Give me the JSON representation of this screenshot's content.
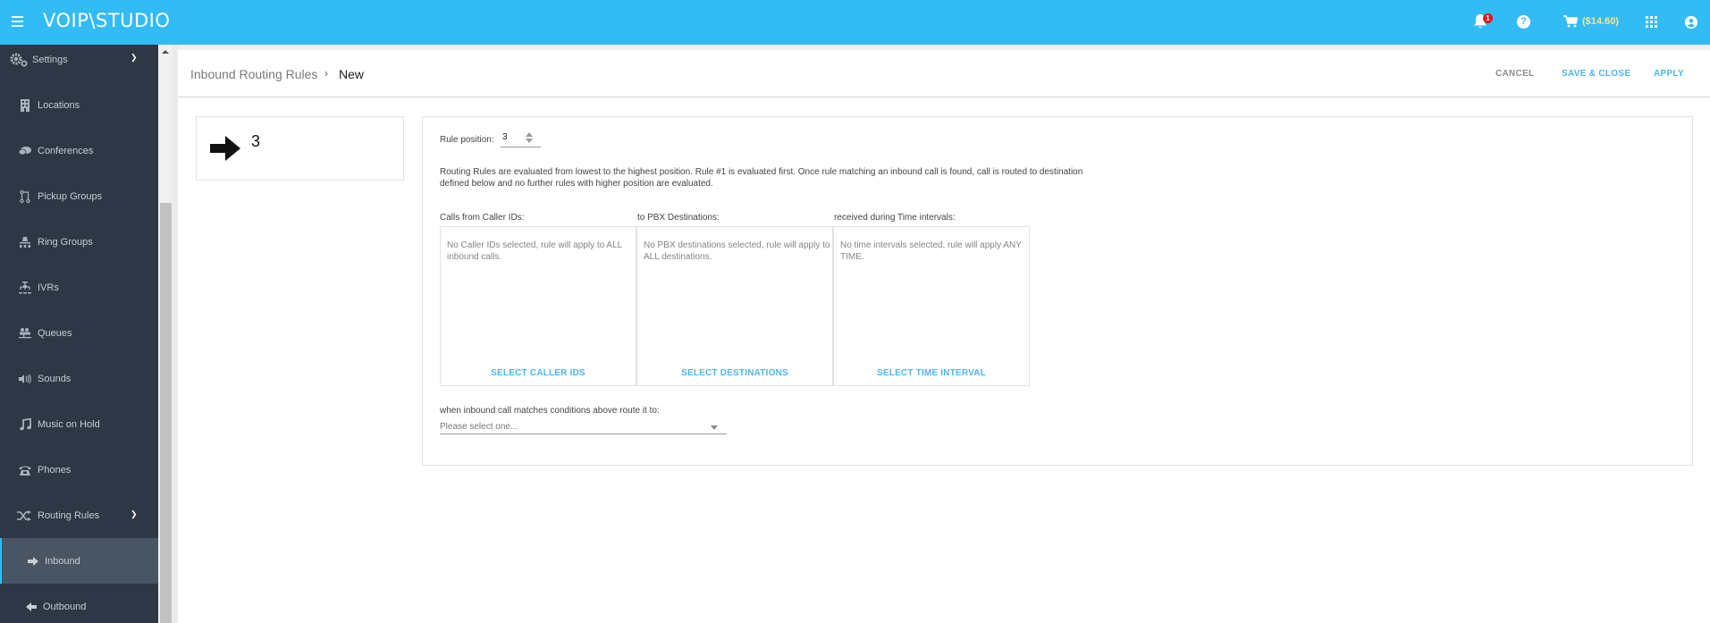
{
  "topbar": {
    "logo": "VOIP\\STUDIO",
    "notification_count": "1",
    "help_glyph": "?",
    "balance": "($14.60)",
    "icons": [
      "hamburger-menu-icon",
      "bell-icon",
      "help-icon",
      "cart-icon",
      "apps-grid-icon",
      "account-icon"
    ]
  },
  "sidebar": {
    "items": [
      {
        "label": "Settings",
        "icon": "gears-icon",
        "expanded": true
      },
      {
        "label": "Locations",
        "icon": "building-icon"
      },
      {
        "label": "Conferences",
        "icon": "chat-bubbles-icon"
      },
      {
        "label": "Pickup Groups",
        "icon": "pickup-group-icon"
      },
      {
        "label": "Ring Groups",
        "icon": "ring-group-icon"
      },
      {
        "label": "IVRs",
        "icon": "ivr-tree-icon"
      },
      {
        "label": "Queues",
        "icon": "queue-icon"
      },
      {
        "label": "Sounds",
        "icon": "speaker-icon"
      },
      {
        "label": "Music on Hold",
        "icon": "music-note-icon"
      },
      {
        "label": "Phones",
        "icon": "telephone-icon"
      },
      {
        "label": "Routing Rules",
        "icon": "shuffle-icon",
        "expanded": true
      },
      {
        "label": "Inbound",
        "icon": "arrow-right-icon",
        "active": true
      },
      {
        "label": "Outbound",
        "icon": "arrow-left-icon"
      }
    ]
  },
  "header": {
    "breadcrumb_parent": "Inbound Routing Rules",
    "breadcrumb_sep": "›",
    "breadcrumb_current": "New",
    "cancel_label": "CANCEL",
    "save_close_label": "SAVE & CLOSE",
    "apply_label": "APPLY"
  },
  "rule_card": {
    "number": "3"
  },
  "form": {
    "rule_position_label": "Rule position:",
    "rule_position_value": "3",
    "description": "Routing Rules are evaluated from lowest to the highest position. Rule #1 is evaluated first. Once rule matching an inbound call is found, call is routed to destination defined below and no further rules with higher position are evaluated.",
    "columns": [
      {
        "label": "Calls from Caller IDs:",
        "empty_text": "No Caller IDs selected, rule will apply to ALL inbound calls.",
        "button": "SELECT CALLER IDS"
      },
      {
        "label": "to PBX Destinations:",
        "empty_text": "No PBX destinations selected, rule will apply to ALL destinations.",
        "button": "SELECT DESTINATIONS"
      },
      {
        "label": "received during Time intervals:",
        "empty_text": "No time intervals selected, rule will apply ANY TIME.",
        "button": "SELECT TIME INTERVAL"
      }
    ],
    "route_label": "when inbound call matches conditions above route it to:",
    "route_placeholder": "Please select one..."
  },
  "colors": {
    "topbar": "#33bbf5",
    "sidebar": "#2d3745",
    "sidebar_active": "#4a5563",
    "accent": "#4bb6ec",
    "balance": "#fbe38b",
    "badge": "#e8121c"
  }
}
